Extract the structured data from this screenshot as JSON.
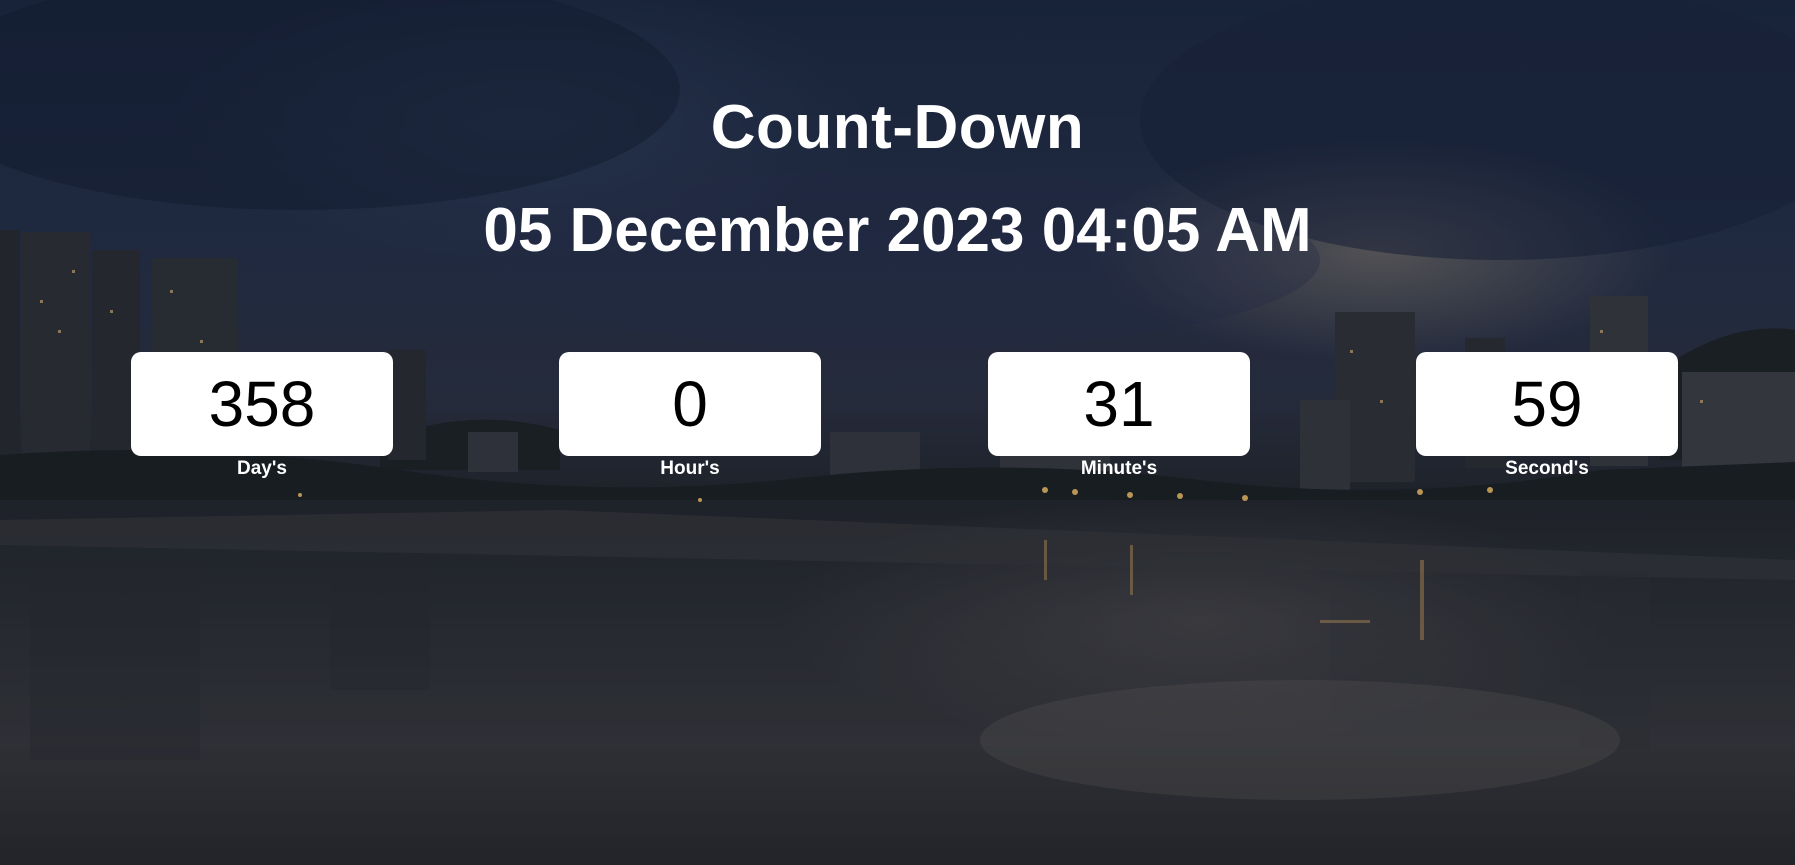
{
  "page": {
    "title": "Count-Down",
    "target_datetime": "05 December 2023 04:05 AM"
  },
  "countdown": {
    "days": {
      "value": "358",
      "label": "Day's"
    },
    "hours": {
      "value": "0",
      "label": "Hour's"
    },
    "minutes": {
      "value": "31",
      "label": "Minute's"
    },
    "seconds": {
      "value": "59",
      "label": "Second's"
    }
  },
  "background": {
    "description_icon": "night-city-river-icon",
    "colors": {
      "sky": "#1d2a45",
      "water": "#2f3238",
      "box": "#ffffff",
      "text": "#ffffff"
    }
  }
}
